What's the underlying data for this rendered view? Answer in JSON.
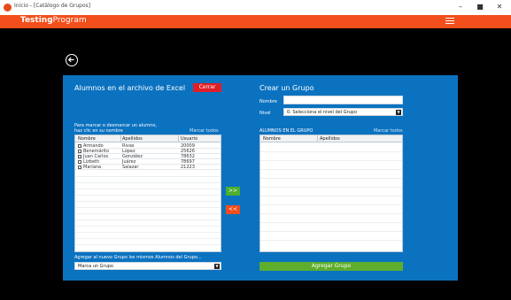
{
  "window": {
    "title": "Inicio - [Catálogo de Grupos]",
    "minimize": "–",
    "maximize": "■",
    "close": "✕"
  },
  "header": {
    "brand_bold": "Testing",
    "brand_rest": "Program"
  },
  "left": {
    "title": "Alumnos en el archivo de Excel",
    "close_label": "Cerrar",
    "hint_line1": "Para marcar o desmarcar un alumno,",
    "hint_line2": "haz clic en su nombre",
    "mark_all": "Marcar todos",
    "columns": [
      "Nombre",
      "Apellidos",
      "Usuario"
    ],
    "rows": [
      [
        "Armando",
        "Rivas",
        "20009"
      ],
      [
        "Benemárito",
        "López",
        "25626"
      ],
      [
        "Juan Carlos",
        "González",
        "78632"
      ],
      [
        "Lizbeth",
        "Juárez",
        "78697"
      ],
      [
        "Mariana",
        "Salazar",
        "21223"
      ]
    ],
    "add_label": "Agregar al nuevo Grupo los mismos Alumnos del Grupo...",
    "add_select_value": "Marca un Grupo"
  },
  "middle": {
    "move_right": ">>",
    "move_left": "<<"
  },
  "right": {
    "title": "Crear un Grupo",
    "name_label": "Nombre",
    "name_value": "",
    "level_label": "Nivel",
    "level_value": "0. Selecciona el nivel del Grupo",
    "group_label": "ALUMNOS EN EL GRUPO",
    "mark_all": "Marcar todos",
    "columns": [
      "Nombre",
      "Apellidos"
    ],
    "submit_label": "Agregar Grupo"
  },
  "colors": {
    "header": "#f24f1c",
    "panel": "#0b72c0",
    "close": "#e01e26",
    "green": "#4caf2f",
    "orange": "#ee4d1d"
  }
}
